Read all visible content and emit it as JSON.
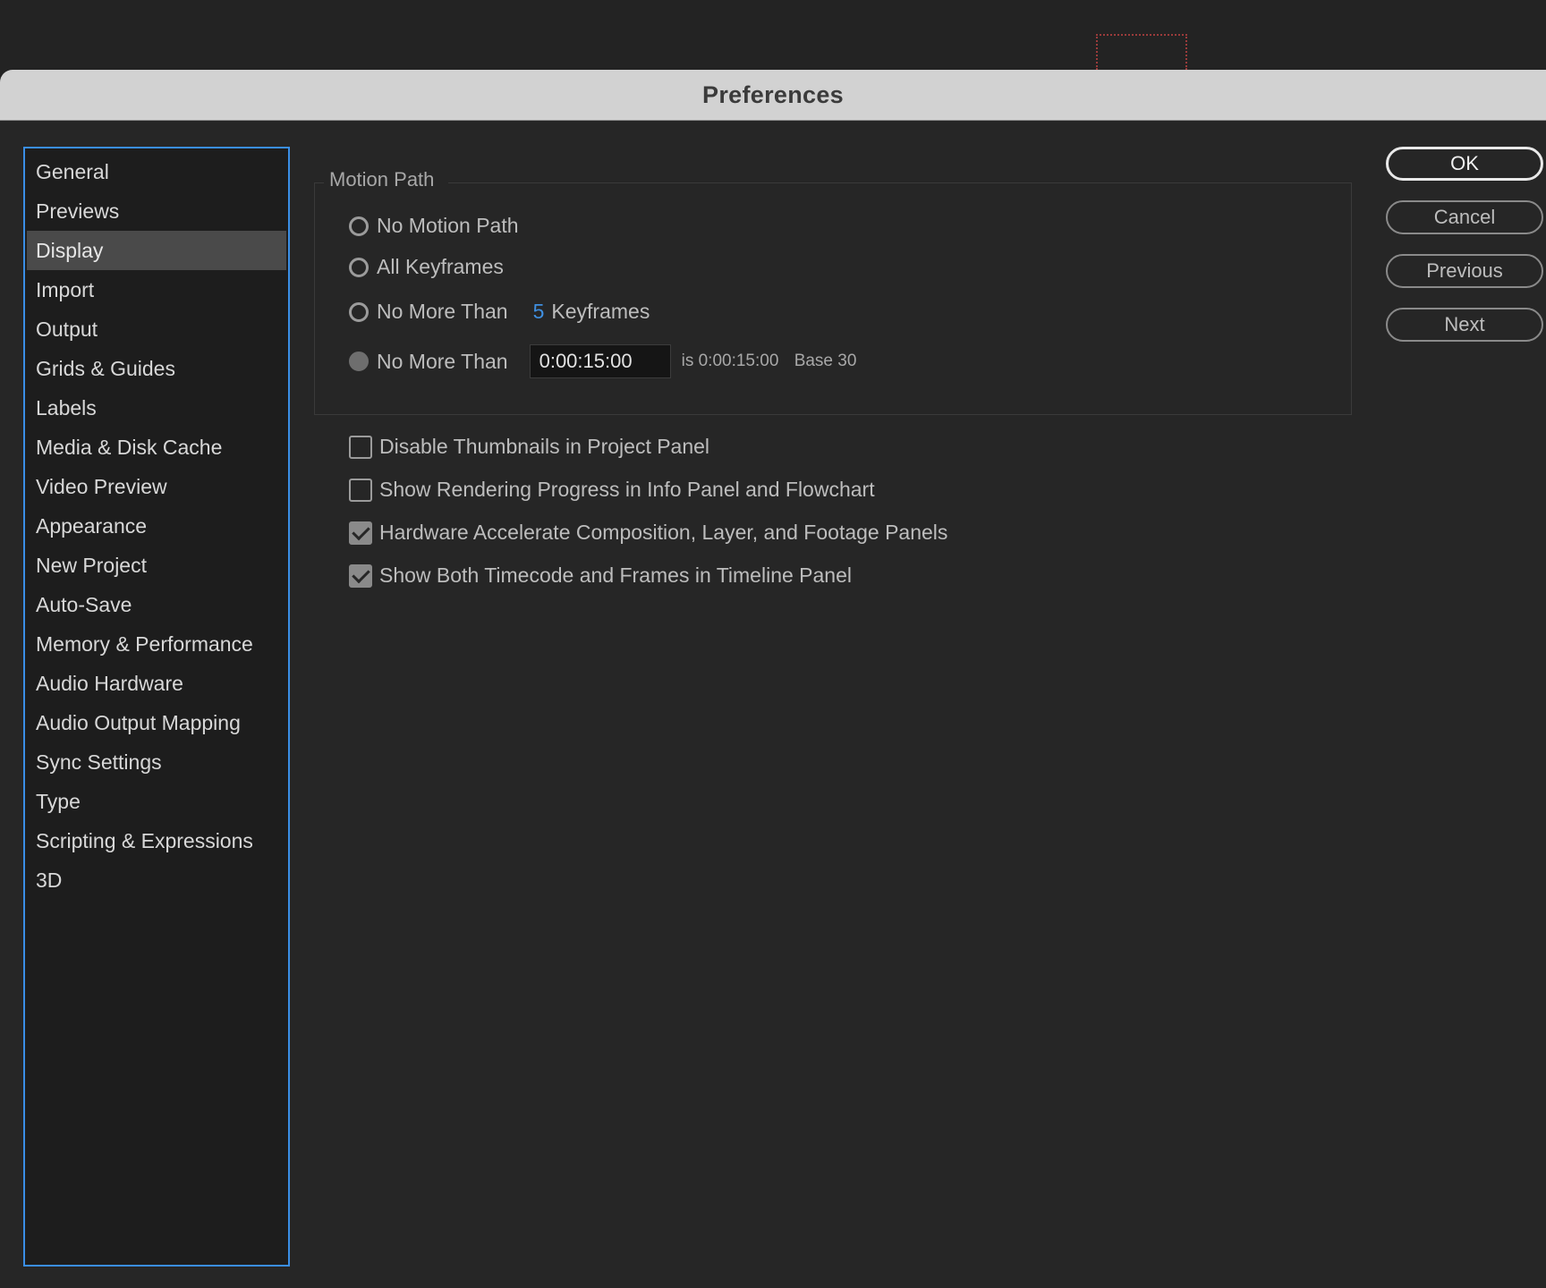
{
  "dialog": {
    "title": "Preferences"
  },
  "sidebar": {
    "items": [
      {
        "label": "General"
      },
      {
        "label": "Previews"
      },
      {
        "label": "Display"
      },
      {
        "label": "Import"
      },
      {
        "label": "Output"
      },
      {
        "label": "Grids & Guides"
      },
      {
        "label": "Labels"
      },
      {
        "label": "Media & Disk Cache"
      },
      {
        "label": "Video Preview"
      },
      {
        "label": "Appearance"
      },
      {
        "label": "New Project"
      },
      {
        "label": "Auto-Save"
      },
      {
        "label": "Memory & Performance"
      },
      {
        "label": "Audio Hardware"
      },
      {
        "label": "Audio Output Mapping"
      },
      {
        "label": "Sync Settings"
      },
      {
        "label": "Type"
      },
      {
        "label": "Scripting & Expressions"
      },
      {
        "label": "3D"
      }
    ],
    "selected": "Display"
  },
  "motion_path": {
    "legend": "Motion Path",
    "options": {
      "none": "No Motion Path",
      "all": "All Keyframes",
      "no_more_than_keyframes": "No More Than",
      "keyframes_value": "5",
      "keyframes_unit": "Keyframes",
      "no_more_than_time": "No More Than",
      "time_value": "0:00:15:00",
      "time_info": "is 0:00:15:00",
      "time_base": "Base 30"
    },
    "selected_option": "No More Than (time)"
  },
  "checkboxes": {
    "disable_thumbnails": {
      "label": "Disable Thumbnails in Project Panel",
      "checked": false
    },
    "show_rendering_progress": {
      "label": "Show Rendering Progress in Info Panel and Flowchart",
      "checked": false
    },
    "hardware_accelerate": {
      "label": "Hardware Accelerate Composition, Layer, and Footage Panels",
      "checked": true
    },
    "show_timecode_frames": {
      "label": "Show Both Timecode and Frames in Timeline Panel",
      "checked": true
    }
  },
  "buttons": {
    "ok": "OK",
    "cancel": "Cancel",
    "previous": "Previous",
    "next": "Next"
  },
  "colors": {
    "accent": "#3f8fe0",
    "sidebar_border": "#3a8ee6",
    "selected_item_bg": "#4a4a4a"
  }
}
